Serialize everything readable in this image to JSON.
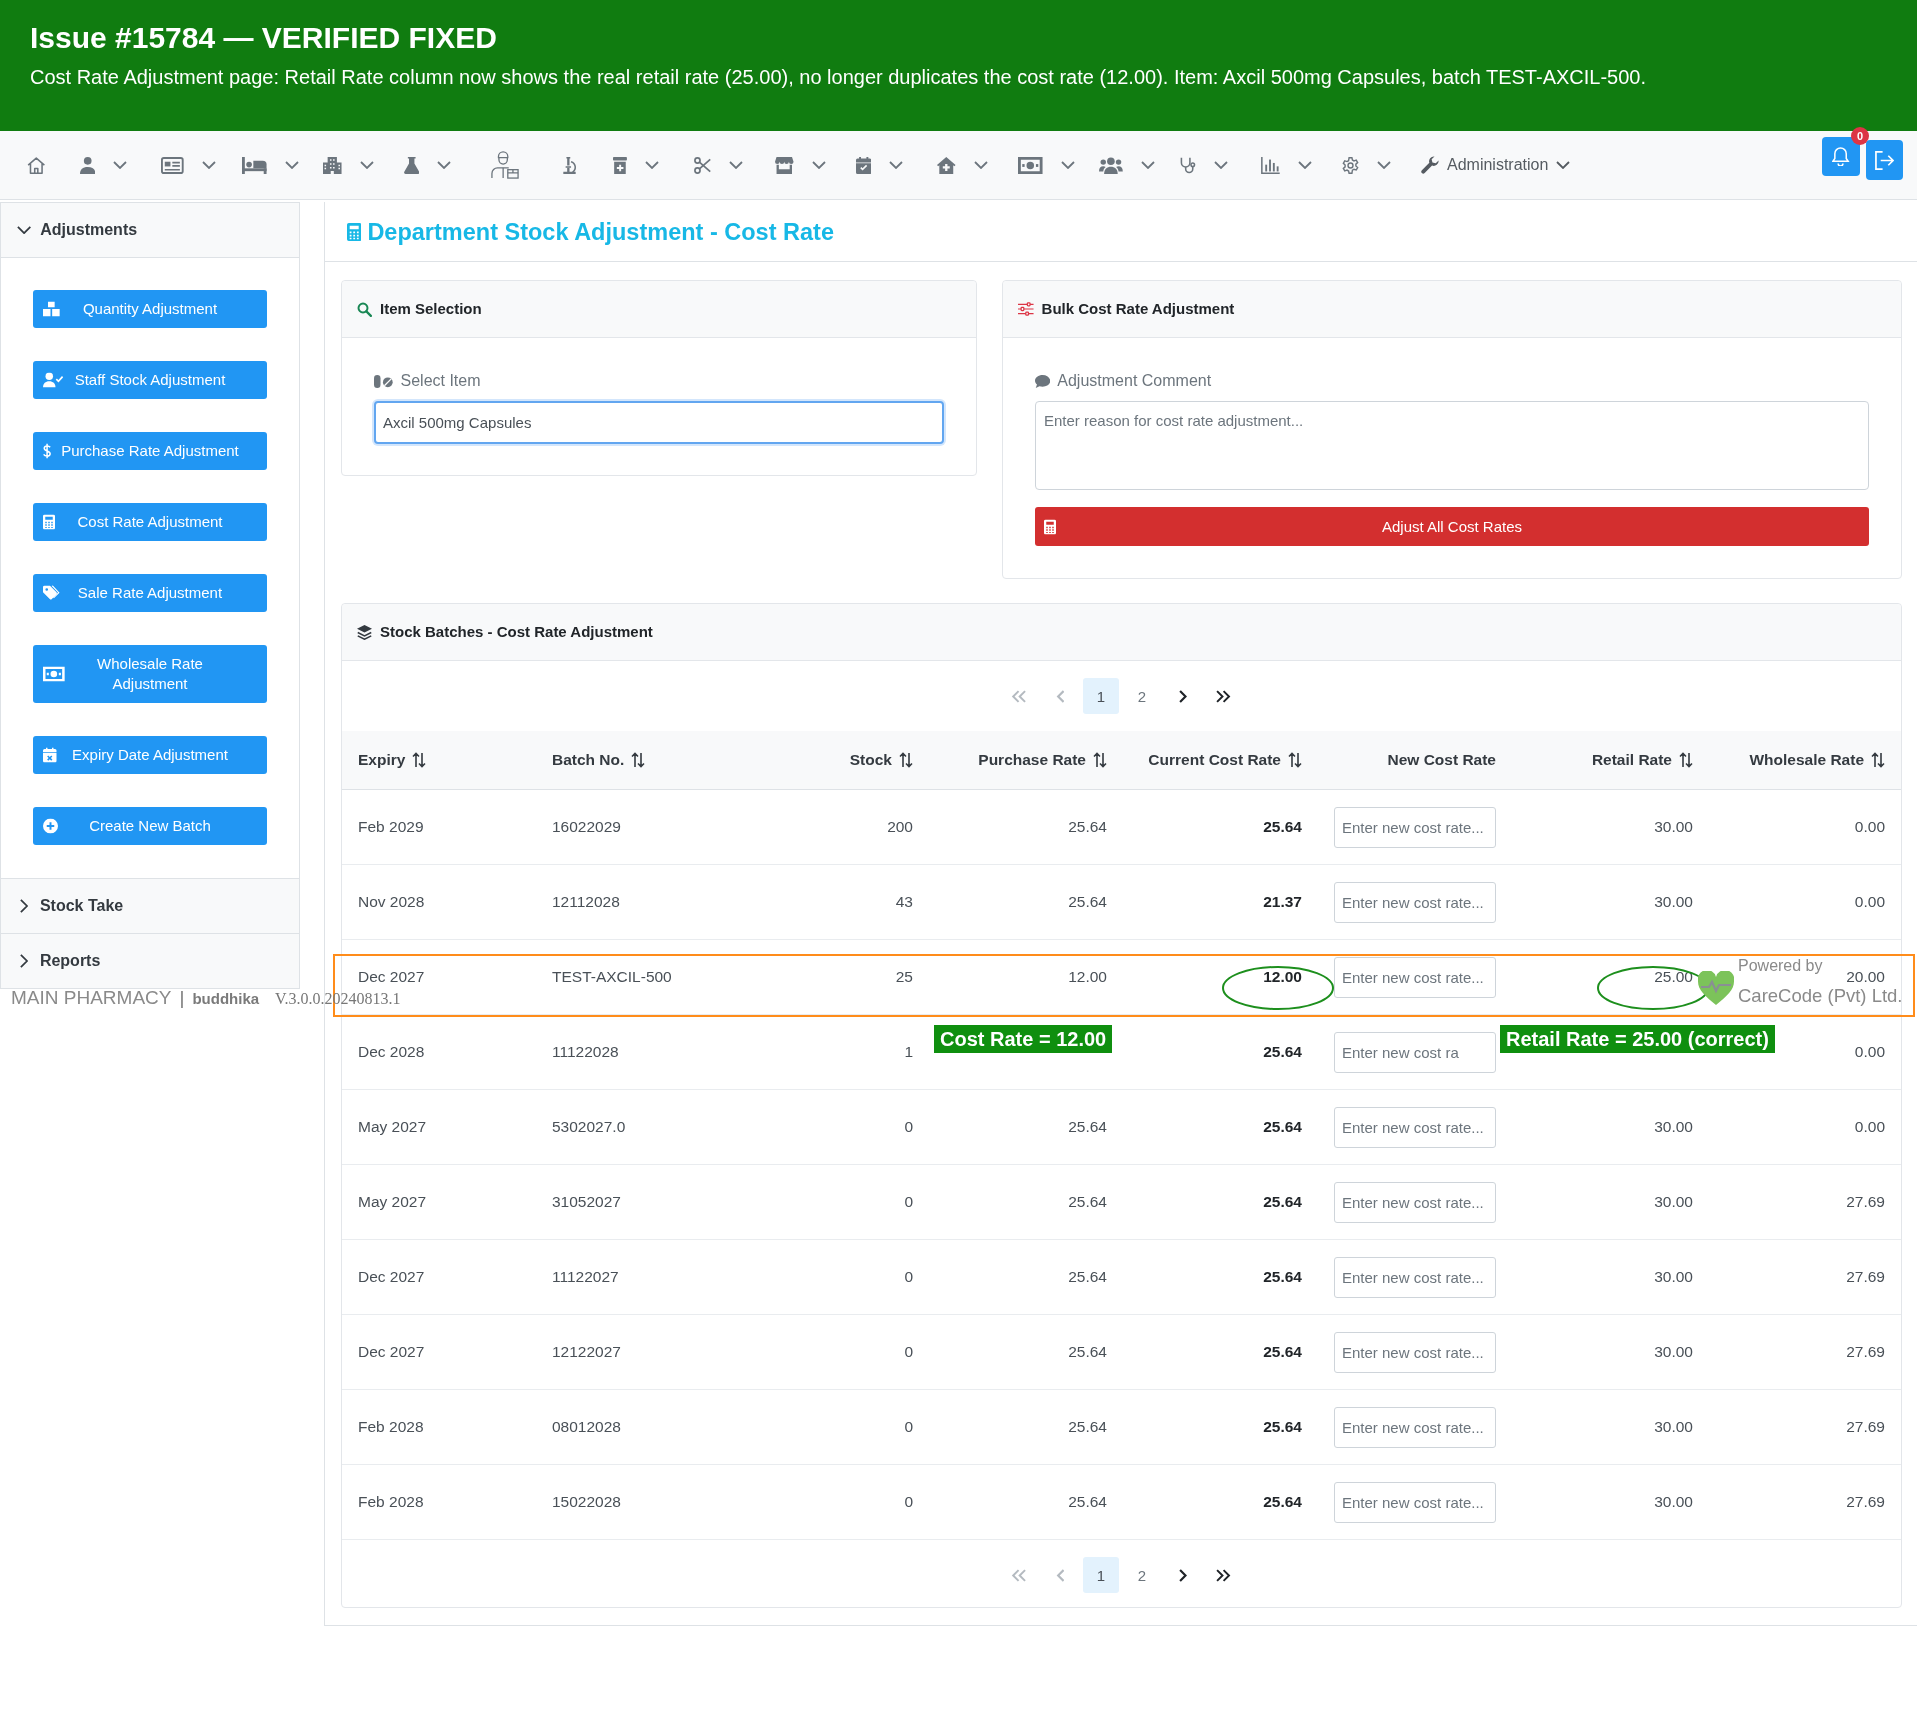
{
  "banner": {
    "title": "Issue #15784 — VERIFIED FIXED",
    "description": "Cost Rate Adjustment page: Retail Rate column now shows the real retail rate (25.00), no longer duplicates the cost rate (12.00). Item: Axcil 500mg Capsules, batch TEST-AXCIL-500."
  },
  "navbar": {
    "items": [
      {
        "dropdown": false
      },
      {
        "dropdown": true
      },
      {
        "dropdown": true
      },
      {
        "dropdown": true
      },
      {
        "dropdown": true
      },
      {
        "dropdown": true
      },
      {
        "dropdown": false
      },
      {
        "dropdown": false
      },
      {
        "dropdown": true
      },
      {
        "dropdown": true
      },
      {
        "dropdown": true
      },
      {
        "dropdown": true
      },
      {
        "dropdown": true
      },
      {
        "dropdown": true
      },
      {
        "dropdown": true
      },
      {
        "dropdown": true
      },
      {
        "dropdown": true
      },
      {
        "dropdown": true
      }
    ],
    "admin": {
      "label": "Administration",
      "dropdown": true
    },
    "notifications": {
      "badge": "0"
    }
  },
  "sidebar": {
    "sections": [
      {
        "title": "Adjustments",
        "expanded": true,
        "items": [
          {
            "label": "Quantity Adjustment"
          },
          {
            "label": "Staff Stock Adjustment"
          },
          {
            "label": "Purchase Rate Adjustment"
          },
          {
            "label": "Cost Rate Adjustment"
          },
          {
            "label": "Sale Rate Adjustment"
          },
          {
            "label": "Wholesale Rate Adjustment"
          },
          {
            "label": "Expiry Date Adjustment"
          },
          {
            "label": "Create New Batch"
          }
        ]
      },
      {
        "title": "Stock Take",
        "expanded": false
      },
      {
        "title": "Reports",
        "expanded": false
      }
    ]
  },
  "page": {
    "title": "Department Stock Adjustment - Cost Rate"
  },
  "item_selection": {
    "title": "Item Selection",
    "field_label": "Select Item",
    "value": "Axcil 500mg Capsules"
  },
  "bulk_adjustment": {
    "title": "Bulk Cost Rate Adjustment",
    "field_label": "Adjustment Comment",
    "placeholder": "Enter reason for cost rate adjustment...",
    "button": "Adjust All Cost Rates"
  },
  "batches": {
    "title": "Stock Batches - Cost Rate Adjustment",
    "pagination_top": {
      "arrows": [
        {
          "kind": "first",
          "disabled": true
        },
        {
          "kind": "previous",
          "disabled": true
        },
        {
          "kind": "next",
          "disabled": false
        },
        {
          "kind": "last",
          "disabled": false
        }
      ],
      "pages": [
        {
          "label": "1",
          "selected": true
        },
        {
          "label": "2",
          "selected": false
        }
      ]
    },
    "columns": [
      {
        "label": "Expiry",
        "kind": "text",
        "sortable": true
      },
      {
        "label": "Batch No.",
        "kind": "text",
        "sortable": true
      },
      {
        "label": "Stock",
        "kind": "number",
        "sortable": true
      },
      {
        "label": "Purchase Rate",
        "kind": "number",
        "sortable": true
      },
      {
        "label": "Current Cost Rate",
        "kind": "emphasis",
        "sortable": true
      },
      {
        "label": "New Cost Rate",
        "kind": "input",
        "sortable": false
      },
      {
        "label": "Retail Rate",
        "kind": "number",
        "sortable": true
      },
      {
        "label": "Wholesale Rate",
        "kind": "number",
        "sortable": true
      }
    ],
    "rows": [
      {
        "expiry": "Feb 2029",
        "batch_no": "16022029",
        "stock": "200",
        "purchase_rate": "25.64",
        "current_cost_rate": "25.64",
        "placeholder": "Enter new cost rate...",
        "retail_rate": "30.00",
        "wholesale_rate": "0.00",
        "highlighted": false,
        "cost_circled": false,
        "retail_circled": false
      },
      {
        "expiry": "Nov 2028",
        "batch_no": "12112028",
        "stock": "43",
        "purchase_rate": "25.64",
        "current_cost_rate": "21.37",
        "placeholder": "Enter new cost rate...",
        "retail_rate": "30.00",
        "wholesale_rate": "0.00",
        "highlighted": false,
        "cost_circled": false,
        "retail_circled": false
      },
      {
        "expiry": "Dec 2027",
        "batch_no": "TEST-AXCIL-500",
        "stock": "25",
        "purchase_rate": "12.00",
        "current_cost_rate": "12.00",
        "placeholder": "Enter new cost rate...",
        "retail_rate": "25.00",
        "wholesale_rate": "20.00",
        "highlighted": true,
        "cost_circled": true,
        "retail_circled": true,
        "cost_note": "Cost Rate = 12.00",
        "retail_note": "Retail Rate = 25.00 (correct)"
      },
      {
        "expiry": "Dec 2028",
        "batch_no": "11122028",
        "stock": "1",
        "current_cost_rate": "25.64",
        "placeholder": "Enter new cost ra",
        "wholesale_rate": "0.00",
        "highlighted": false,
        "cost_circled": false,
        "retail_circled": false
      },
      {
        "expiry": "May 2027",
        "batch_no": "5302027.0",
        "stock": "0",
        "purchase_rate": "25.64",
        "current_cost_rate": "25.64",
        "placeholder": "Enter new cost rate...",
        "retail_rate": "30.00",
        "wholesale_rate": "0.00",
        "highlighted": false,
        "cost_circled": false,
        "retail_circled": false
      },
      {
        "expiry": "May 2027",
        "batch_no": "31052027",
        "stock": "0",
        "purchase_rate": "25.64",
        "current_cost_rate": "25.64",
        "placeholder": "Enter new cost rate...",
        "retail_rate": "30.00",
        "wholesale_rate": "27.69",
        "highlighted": false,
        "cost_circled": false,
        "retail_circled": false
      },
      {
        "expiry": "Dec 2027",
        "batch_no": "11122027",
        "stock": "0",
        "purchase_rate": "25.64",
        "current_cost_rate": "25.64",
        "placeholder": "Enter new cost rate...",
        "retail_rate": "30.00",
        "wholesale_rate": "27.69",
        "highlighted": false,
        "cost_circled": false,
        "retail_circled": false
      },
      {
        "expiry": "Dec 2027",
        "batch_no": "12122027",
        "stock": "0",
        "purchase_rate": "25.64",
        "current_cost_rate": "25.64",
        "placeholder": "Enter new cost rate...",
        "retail_rate": "30.00",
        "wholesale_rate": "27.69",
        "highlighted": false,
        "cost_circled": false,
        "retail_circled": false
      },
      {
        "expiry": "Feb 2028",
        "batch_no": "08012028",
        "stock": "0",
        "purchase_rate": "25.64",
        "current_cost_rate": "25.64",
        "placeholder": "Enter new cost rate...",
        "retail_rate": "30.00",
        "wholesale_rate": "27.69",
        "highlighted": false,
        "cost_circled": false,
        "retail_circled": false
      },
      {
        "expiry": "Feb 2028",
        "batch_no": "15022028",
        "stock": "0",
        "purchase_rate": "25.64",
        "current_cost_rate": "25.64",
        "placeholder": "Enter new cost rate...",
        "retail_rate": "30.00",
        "wholesale_rate": "27.69",
        "highlighted": false,
        "cost_circled": false,
        "retail_circled": false
      }
    ],
    "pagination_bottom": {
      "arrows": [
        {
          "kind": "first",
          "disabled": true
        },
        {
          "kind": "previous",
          "disabled": true
        },
        {
          "kind": "next",
          "disabled": false
        },
        {
          "kind": "last",
          "disabled": false
        }
      ],
      "pages": [
        {
          "label": "1",
          "selected": true
        },
        {
          "label": "2",
          "selected": false
        }
      ]
    }
  },
  "footer": {
    "location": "MAIN PHARMACY",
    "separator": "|",
    "user": "buddhika",
    "version": "V.3.0.0.20240813.1",
    "powered_by": "Powered by",
    "company": "CareCode (Pvt) Ltd."
  }
}
